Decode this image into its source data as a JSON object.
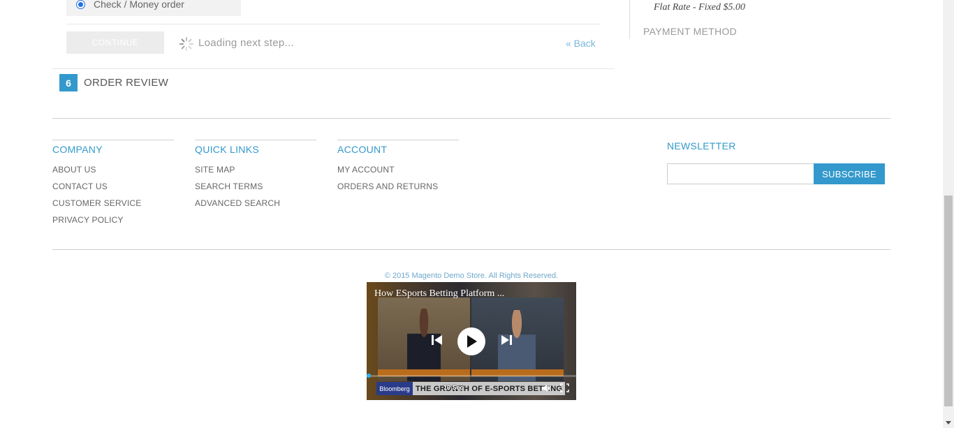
{
  "checkout": {
    "payment_option_label": "Check / Money order",
    "continue_label": "CONTINUE",
    "loading_text": "Loading next step...",
    "back_label": "« Back",
    "step_number": "6",
    "step_title": "ORDER REVIEW"
  },
  "progress": {
    "shipping_rate": "Flat Rate - Fixed $5.00",
    "payment_heading": "PAYMENT METHOD"
  },
  "footer": {
    "columns": [
      {
        "title": "COMPANY",
        "links": [
          "ABOUT US",
          "CONTACT US",
          "CUSTOMER SERVICE",
          "PRIVACY POLICY"
        ]
      },
      {
        "title": "QUICK LINKS",
        "links": [
          "SITE MAP",
          "SEARCH TERMS",
          "ADVANCED SEARCH"
        ]
      },
      {
        "title": "ACCOUNT",
        "links": [
          "MY ACCOUNT",
          "ORDERS AND RETURNS"
        ]
      }
    ],
    "newsletter": {
      "title": "NEWSLETTER",
      "input_value": "",
      "button_label": "SUBSCRIBE"
    },
    "copyright": "© 2015 Magento Demo Store. All Rights Reserved."
  },
  "video": {
    "title": "How ESports Betting Platform ...",
    "ticker_brand": "Bloomberg",
    "ticker_text": "THE GROWTH OF E-SPORTS BETTING",
    "seek_label": "10 Sec",
    "progress_fraction": 0.01
  },
  "colors": {
    "accent": "#3399cc",
    "progress": "#29b6f6"
  }
}
